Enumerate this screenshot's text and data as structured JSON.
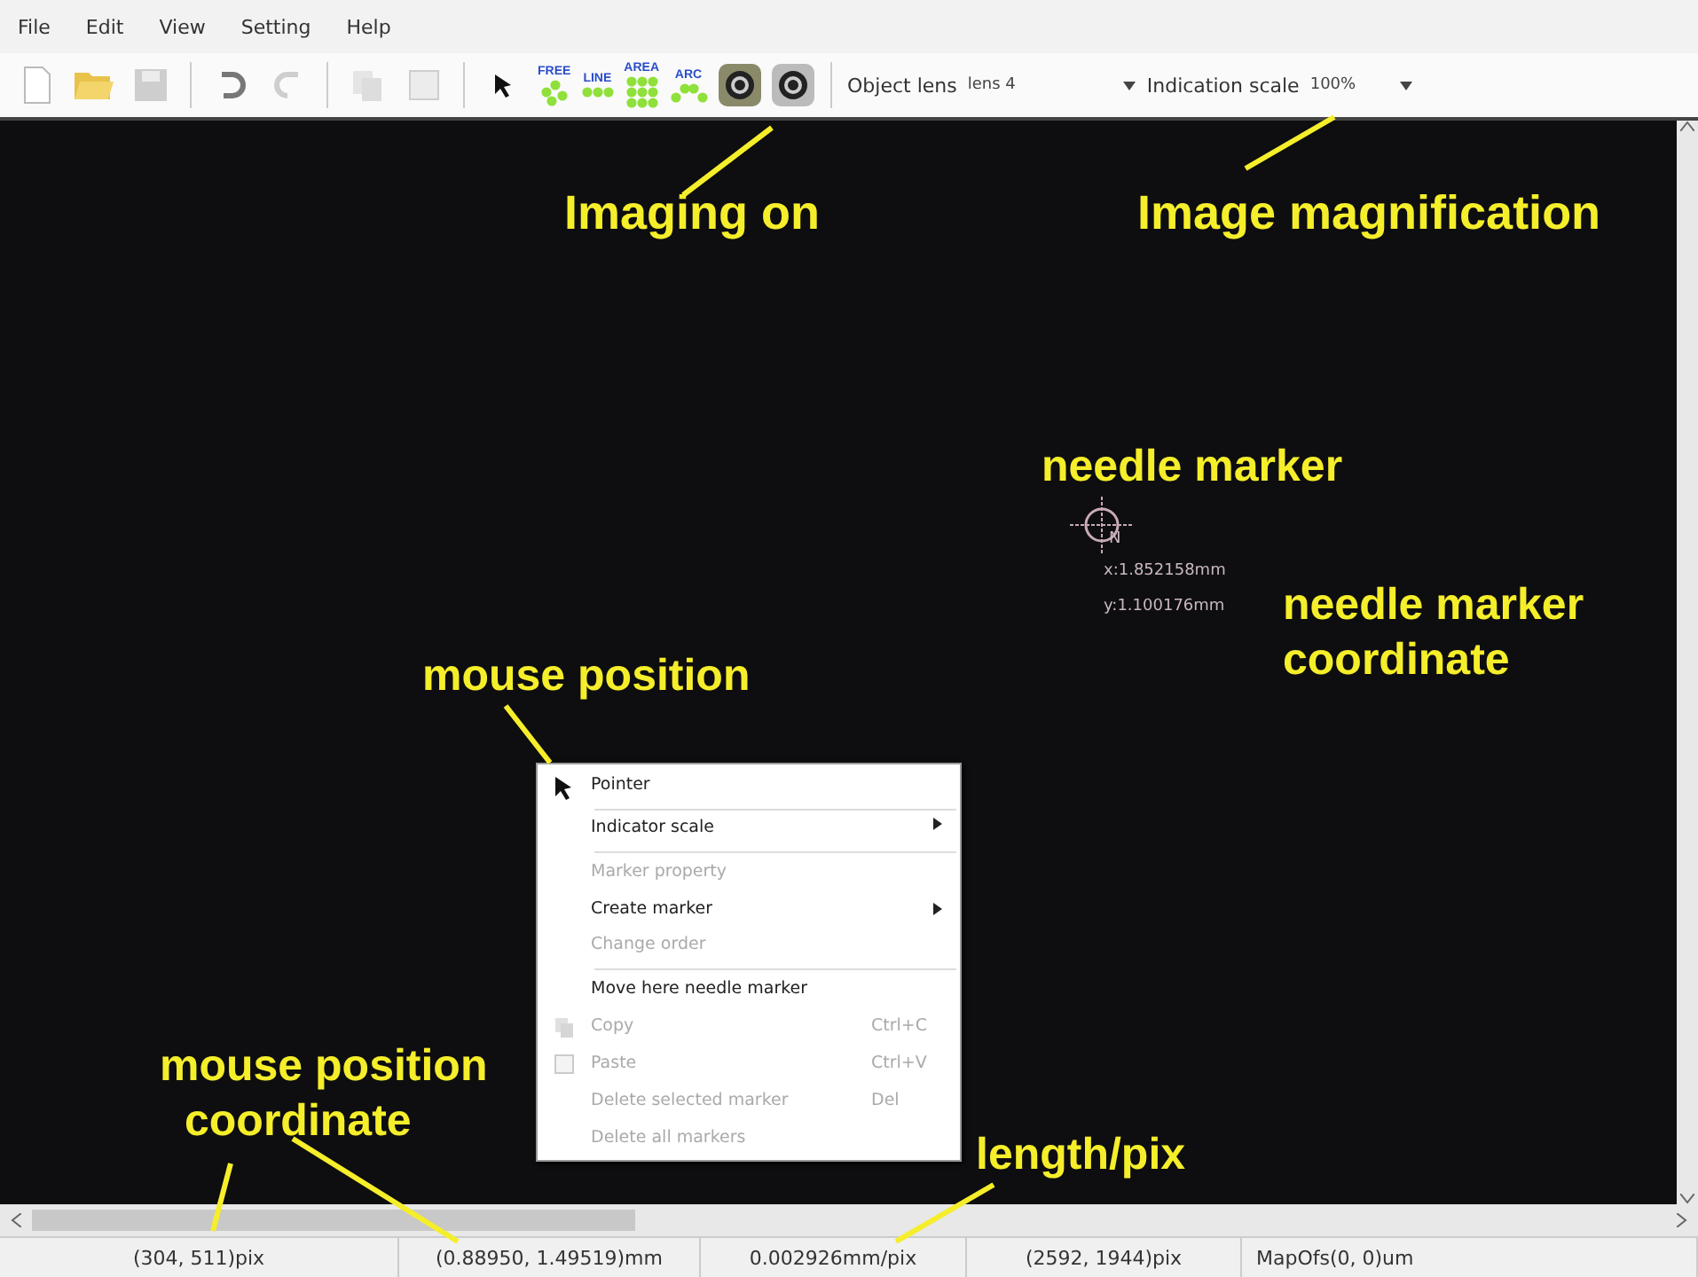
{
  "menu_bar": [
    "File",
    "Edit",
    "View",
    "Setting",
    "Help"
  ],
  "toolbar": {
    "buttons": [
      {
        "kind": "new",
        "disabled": false
      },
      {
        "kind": "open",
        "disabled": false
      },
      {
        "kind": "save",
        "disabled": true
      },
      {
        "kind": "undo",
        "disabled": false
      },
      {
        "kind": "redo",
        "disabled": true
      },
      {
        "kind": "copy",
        "disabled": true
      },
      {
        "kind": "paste",
        "disabled": true
      },
      {
        "kind": "pointer",
        "disabled": false
      }
    ],
    "tools": [
      {
        "label": "FREE",
        "kind": "free"
      },
      {
        "label": "LINE",
        "kind": "line"
      },
      {
        "label": "AREA",
        "kind": "area"
      },
      {
        "label": "ARC",
        "kind": "arc"
      }
    ],
    "camera_buttons": [
      {
        "on": true
      },
      {
        "on": false
      }
    ],
    "object_lens": {
      "label": "Object lens",
      "value": "lens 4"
    },
    "indication_scale": {
      "label": "Indication scale",
      "value": "100%"
    }
  },
  "needle_marker": {
    "letter": "N",
    "x": "x:1.852158mm",
    "y": "y:1.100176mm"
  },
  "context_menu": [
    {
      "label": "Pointer",
      "kind": "pointer",
      "disabled": false,
      "submenu": false,
      "separator_after": true
    },
    {
      "label": "Indicator scale",
      "disabled": false,
      "submenu": true,
      "separator_after": true
    },
    {
      "label": "Marker property",
      "disabled": true,
      "submenu": false
    },
    {
      "label": "Create marker",
      "disabled": false,
      "submenu": true
    },
    {
      "label": "Change order",
      "disabled": true,
      "submenu": false,
      "separator_after": true
    },
    {
      "label": "Move here needle marker",
      "disabled": false,
      "submenu": false
    },
    {
      "label": "Copy",
      "kind": "copy",
      "shortcut": "Ctrl+C",
      "disabled": true,
      "submenu": false
    },
    {
      "label": "Paste",
      "kind": "paste",
      "shortcut": "Ctrl+V",
      "disabled": true,
      "submenu": false
    },
    {
      "label": "Delete selected marker",
      "shortcut": "Del",
      "disabled": true,
      "submenu": false
    },
    {
      "label": "Delete all markers",
      "disabled": true,
      "submenu": false
    }
  ],
  "annotations": [
    {
      "lines": [
        "Imaging on"
      ]
    },
    {
      "lines": [
        "Image magnification"
      ]
    },
    {
      "lines": [
        "needle marker"
      ]
    },
    {
      "lines": [
        "needle marker",
        "coordinate"
      ]
    },
    {
      "lines": [
        "mouse position"
      ]
    },
    {
      "lines": [
        "mouse position",
        "coordinate"
      ]
    },
    {
      "lines": [
        "length/pix"
      ]
    }
  ],
  "status_bar": [
    "(304, 511)pix",
    "(0.88950, 1.49519)mm",
    "0.002926mm/pix",
    "(2592, 1944)pix",
    "MapOfs(0, 0)um"
  ]
}
